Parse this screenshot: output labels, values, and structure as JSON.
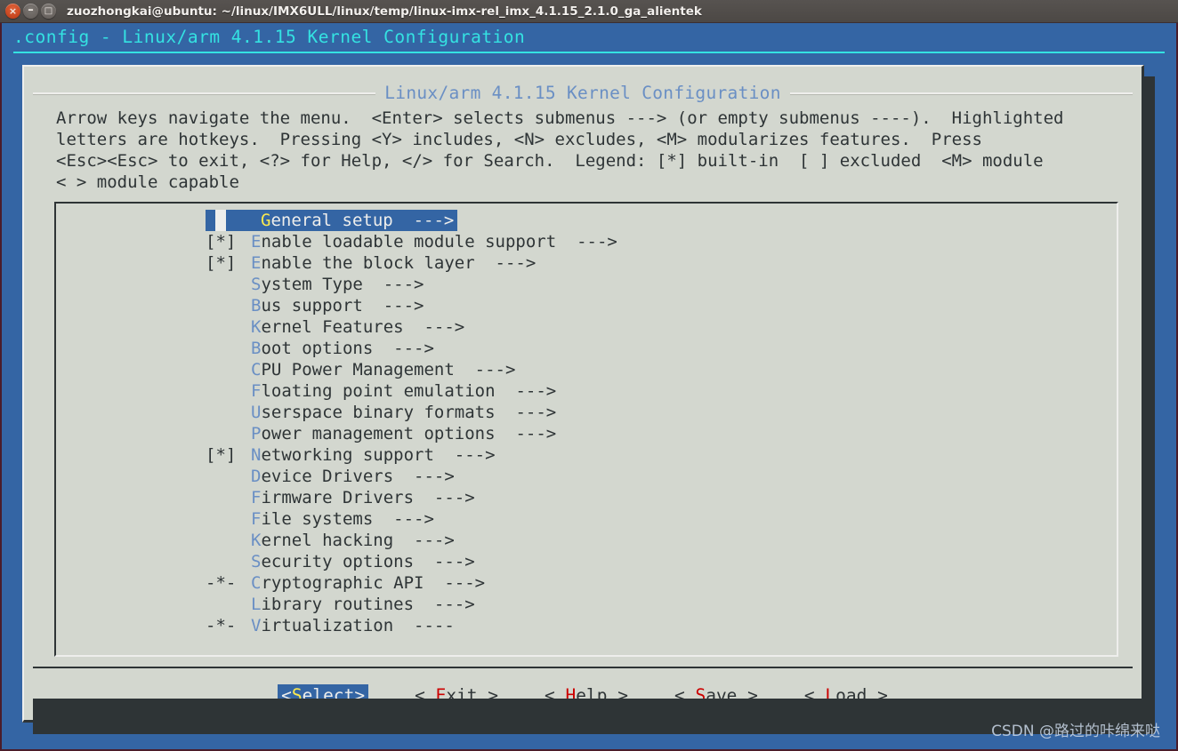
{
  "window": {
    "title": "zuozhongkai@ubuntu: ~/linux/IMX6ULL/linux/temp/linux-imx-rel_imx_4.1.15_2.1.0_ga_alientek",
    "controls": {
      "close_glyph": "×",
      "minimize_glyph": "–",
      "maximize_glyph": "□"
    }
  },
  "terminal": {
    "backtitle": ".config - Linux/arm 4.1.15 Kernel Configuration",
    "backtitle_color": "#34e2e2",
    "background_color": "#3465a4"
  },
  "dialog": {
    "title": "Linux/arm 4.1.15 Kernel Configuration",
    "title_color": "#6a8fc4",
    "background_color": "#d3d7cf",
    "prompt": "Arrow keys navigate the menu.  <Enter> selects submenus ---> (or empty submenus ----).  Highlighted\nletters are hotkeys.  Pressing <Y> includes, <N> excludes, <M> modularizes features.  Press\n<Esc><Esc> to exit, <?> for Help, </> for Search.  Legend: [*] built-in  [ ] excluded  <M> module\n< > module capable"
  },
  "menu": {
    "selected_index": 0,
    "selected_bg": "#3465a4",
    "hotkey_color": "#6a8fc4",
    "selected_hotkey_color": "#fce94f",
    "items": [
      {
        "mark": "",
        "hot": "G",
        "label": "eneral setup",
        "arrow": "  --->"
      },
      {
        "mark": "[*]",
        "hot": "E",
        "label": "nable loadable module support",
        "arrow": "  --->"
      },
      {
        "mark": "[*]",
        "hot": "E",
        "label": "nable the block layer",
        "arrow": "  --->"
      },
      {
        "mark": "",
        "hot": "S",
        "label": "ystem Type",
        "arrow": "  --->"
      },
      {
        "mark": "",
        "hot": "B",
        "label": "us support",
        "arrow": "  --->"
      },
      {
        "mark": "",
        "hot": "K",
        "label": "ernel Features",
        "arrow": "  --->"
      },
      {
        "mark": "",
        "hot": "B",
        "label": "oot options",
        "arrow": "  --->"
      },
      {
        "mark": "",
        "hot": "C",
        "label": "PU Power Management",
        "arrow": "  --->"
      },
      {
        "mark": "",
        "hot": "F",
        "label": "loating point emulation",
        "arrow": "  --->"
      },
      {
        "mark": "",
        "hot": "U",
        "label": "serspace binary formats",
        "arrow": "  --->"
      },
      {
        "mark": "",
        "hot": "P",
        "label": "ower management options",
        "arrow": "  --->"
      },
      {
        "mark": "[*]",
        "hot": "N",
        "label": "etworking support",
        "arrow": "  --->"
      },
      {
        "mark": "",
        "hot": "D",
        "label": "evice Drivers",
        "arrow": "  --->"
      },
      {
        "mark": "",
        "hot": "F",
        "label": "irmware Drivers",
        "arrow": "  --->"
      },
      {
        "mark": "",
        "hot": "F",
        "label": "ile systems",
        "arrow": "  --->"
      },
      {
        "mark": "",
        "hot": "K",
        "label": "ernel hacking",
        "arrow": "  --->"
      },
      {
        "mark": "",
        "hot": "S",
        "label": "ecurity options",
        "arrow": "  --->"
      },
      {
        "mark": "-*-",
        "hot": "C",
        "label": "ryptographic API",
        "arrow": "  --->"
      },
      {
        "mark": "",
        "hot": "L",
        "label": "ibrary routines",
        "arrow": "  --->"
      },
      {
        "mark": "-*-",
        "hot": "V",
        "label": "irtualization",
        "arrow": "  ----"
      }
    ]
  },
  "buttons": {
    "active_index": 0,
    "hotkey_color": "#cc0000",
    "items": [
      {
        "pre": "<",
        "hot": "S",
        "post": "elect>",
        "active": true
      },
      {
        "pre": "< ",
        "hot": "E",
        "post": "xit >",
        "active": false
      },
      {
        "pre": "< ",
        "hot": "H",
        "post": "elp >",
        "active": false
      },
      {
        "pre": "< ",
        "hot": "S",
        "post": "ave >",
        "active": false
      },
      {
        "pre": "< ",
        "hot": "L",
        "post": "oad >",
        "active": false
      }
    ]
  },
  "watermark": {
    "text": "CSDN @路过的咔绵来哒"
  }
}
